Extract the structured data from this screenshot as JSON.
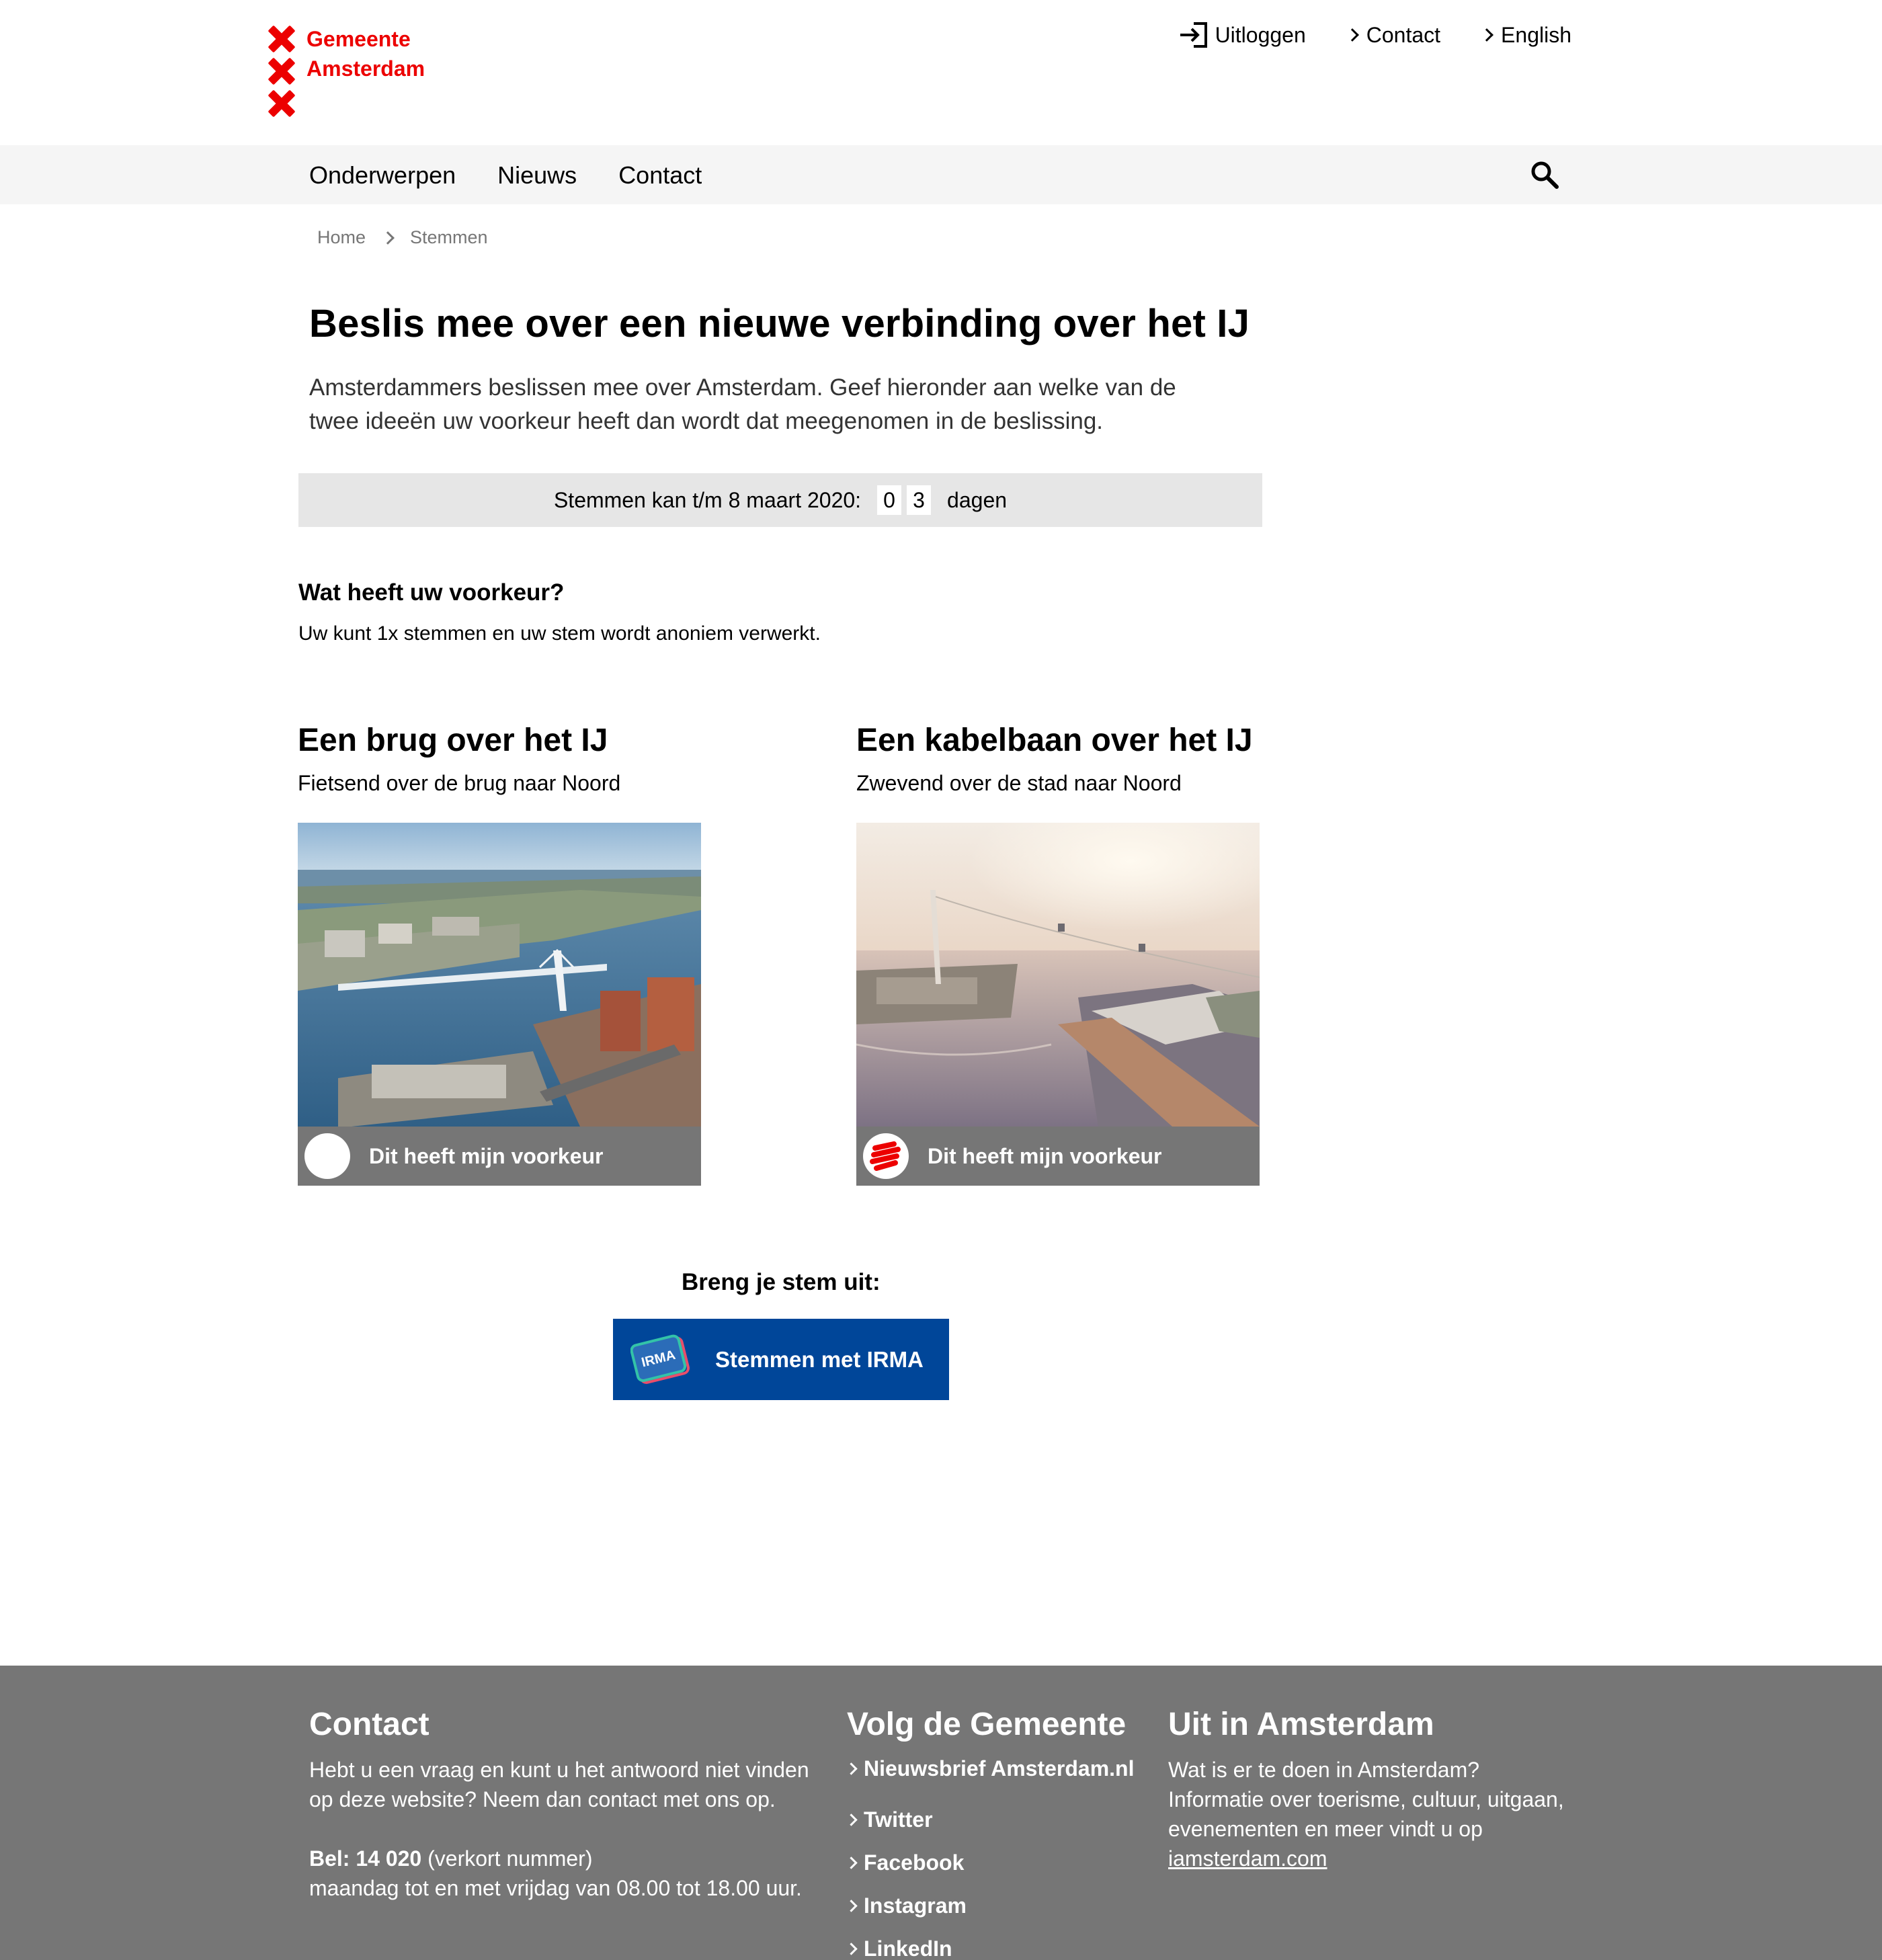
{
  "header": {
    "logo_line1": "Gemeente",
    "logo_line2": "Amsterdam",
    "links": {
      "logout": "Uitloggen",
      "contact": "Contact",
      "english": "English"
    }
  },
  "nav": {
    "items": [
      "Onderwerpen",
      "Nieuws",
      "Contact"
    ]
  },
  "breadcrumb": [
    "Home",
    "Stemmen"
  ],
  "main": {
    "title": "Beslis mee over een nieuwe verbinding over het IJ",
    "intro_line1": "Amsterdammers beslissen mee over Amsterdam. Geef hieronder aan welke van de",
    "intro_line2": "twee ideeën uw voorkeur heeft dan wordt dat meegenomen in de beslissing.",
    "countdown": {
      "label": "Stemmen kan t/m 8 maart 2020:",
      "digit1": "0",
      "digit2": "3",
      "unit": "dagen"
    },
    "preference_title": "Wat heeft uw voorkeur?",
    "preference_sub": "Uw kunt 1x stemmen en uw stem wordt anoniem verwerkt.",
    "options": [
      {
        "title": "Een brug over het IJ",
        "subtitle": "Fietsend over de brug naar Noord",
        "button_label": "Dit heeft mijn voorkeur",
        "selected": false
      },
      {
        "title": "Een kabelbaan over het IJ",
        "subtitle": "Zwevend over de stad naar Noord",
        "button_label": "Dit heeft mijn voorkeur",
        "selected": true
      }
    ],
    "vote_label": "Breng je stem uit:",
    "irma_button": "Stemmen met IRMA",
    "irma_logo_text": "IRMA"
  },
  "footer": {
    "contact": {
      "title": "Contact",
      "text": "Hebt u een vraag en kunt u het antwoord niet vinden op deze website? Neem dan contact met ons op.",
      "phone_label": "Bel: 14 020",
      "phone_note": "(verkort nummer)",
      "hours": "maandag tot en met vrijdag van 08.00 tot 18.00 uur."
    },
    "follow": {
      "title": "Volg de Gemeente",
      "links": [
        "Nieuwsbrief Amsterdam.nl",
        "Twitter",
        "Facebook",
        "Instagram",
        "LinkedIn"
      ]
    },
    "uit": {
      "title": "Uit in Amsterdam",
      "text": "Wat is er te doen in Amsterdam? Informatie over toerisme, cultuur, uitgaan, evenementen en meer vindt u op",
      "link": "iamsterdam.com"
    }
  },
  "colors": {
    "brand_red": "#ec0000",
    "irma_blue": "#004699",
    "footer_grey": "#767676",
    "nav_bg": "#f5f5f5",
    "countdown_bg": "#e6e6e6"
  }
}
